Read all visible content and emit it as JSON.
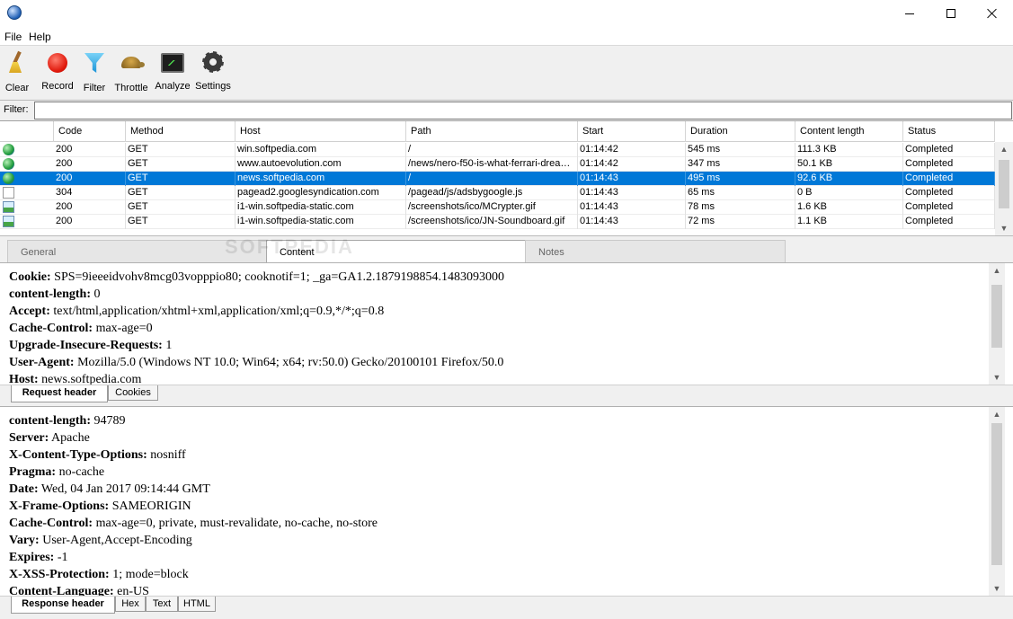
{
  "window": {
    "title": ""
  },
  "menu": {
    "file": "File",
    "help": "Help"
  },
  "toolbar": {
    "clear": "Clear",
    "record": "Record",
    "filter": "Filter",
    "throttle": "Throttle",
    "analyze": "Analyze",
    "settings": "Settings"
  },
  "filter": {
    "label": "Filter:",
    "value": ""
  },
  "grid": {
    "columns": [
      "Code",
      "Method",
      "Host",
      "Path",
      "Start",
      "Duration",
      "Content length",
      "Status"
    ],
    "rows": [
      {
        "icon": "globe-icon",
        "code": "200",
        "method": "GET",
        "host": "win.softpedia.com",
        "path": "/",
        "start": "01:14:42",
        "duration": "545 ms",
        "length": "111.3 KB",
        "status": "Completed"
      },
      {
        "icon": "globe-icon",
        "code": "200",
        "method": "GET",
        "host": "www.autoevolution.com",
        "path": "/news/nero-f50-is-what-ferrari-drea…",
        "start": "01:14:42",
        "duration": "347 ms",
        "length": "50.1 KB",
        "status": "Completed"
      },
      {
        "icon": "globe-icon",
        "code": "200",
        "method": "GET",
        "host": "news.softpedia.com",
        "path": "/",
        "start": "01:14:43",
        "duration": "495 ms",
        "length": "92.6 KB",
        "status": "Completed"
      },
      {
        "icon": "document-icon",
        "code": "304",
        "method": "GET",
        "host": "pagead2.googlesyndication.com",
        "path": "/pagead/js/adsbygoogle.js",
        "start": "01:14:43",
        "duration": "65 ms",
        "length": "0 B",
        "status": "Completed"
      },
      {
        "icon": "image-icon",
        "code": "200",
        "method": "GET",
        "host": "i1-win.softpedia-static.com",
        "path": "/screenshots/ico/MCrypter.gif",
        "start": "01:14:43",
        "duration": "78 ms",
        "length": "1.6 KB",
        "status": "Completed"
      },
      {
        "icon": "image-icon",
        "code": "200",
        "method": "GET",
        "host": "i1-win.softpedia-static.com",
        "path": "/screenshots/ico/JN-Soundboard.gif",
        "start": "01:14:43",
        "duration": "72 ms",
        "length": "1.1 KB",
        "status": "Completed"
      }
    ],
    "selected_row": 2
  },
  "detail_tabs": {
    "general": "General",
    "content": "Content",
    "notes": "Notes",
    "active": "Content"
  },
  "watermark": "SOFTPEDIA",
  "request_headers": [
    {
      "name": "Cookie:",
      "value": "SPS=9ieeeidvohv8mcg03vopppio80; cooknotif=1; _ga=GA1.2.1879198854.1483093000"
    },
    {
      "name": "content-length:",
      "value": "0"
    },
    {
      "name": "Accept:",
      "value": "text/html,application/xhtml+xml,application/xml;q=0.9,*/*;q=0.8"
    },
    {
      "name": "Cache-Control:",
      "value": "max-age=0"
    },
    {
      "name": "Upgrade-Insecure-Requests:",
      "value": "1"
    },
    {
      "name": "User-Agent:",
      "value": "Mozilla/5.0 (Windows NT 10.0; Win64; x64; rv:50.0) Gecko/20100101 Firefox/50.0"
    },
    {
      "name": "Host:",
      "value": "news.softpedia.com"
    }
  ],
  "request_subtabs": {
    "request_header": "Request header",
    "cookies": "Cookies"
  },
  "response_headers": [
    {
      "name": "content-length:",
      "value": "94789"
    },
    {
      "name": "Server:",
      "value": "Apache"
    },
    {
      "name": "X-Content-Type-Options:",
      "value": "nosniff"
    },
    {
      "name": "Pragma:",
      "value": "no-cache"
    },
    {
      "name": "Date:",
      "value": "Wed, 04 Jan 2017 09:14:44 GMT"
    },
    {
      "name": "X-Frame-Options:",
      "value": "SAMEORIGIN"
    },
    {
      "name": "Cache-Control:",
      "value": "max-age=0, private, must-revalidate, no-cache, no-store"
    },
    {
      "name": "Vary:",
      "value": "User-Agent,Accept-Encoding"
    },
    {
      "name": "Expires:",
      "value": "-1"
    },
    {
      "name": "X-XSS-Protection:",
      "value": "1; mode=block"
    },
    {
      "name": "Content-Language:",
      "value": "en-US"
    }
  ],
  "response_subtabs": {
    "response_header": "Response header",
    "hex": "Hex",
    "text": "Text",
    "html": "HTML"
  },
  "colors": {
    "selection": "#0078d7",
    "record": "#e0180b",
    "filter": "#1b94d8"
  }
}
